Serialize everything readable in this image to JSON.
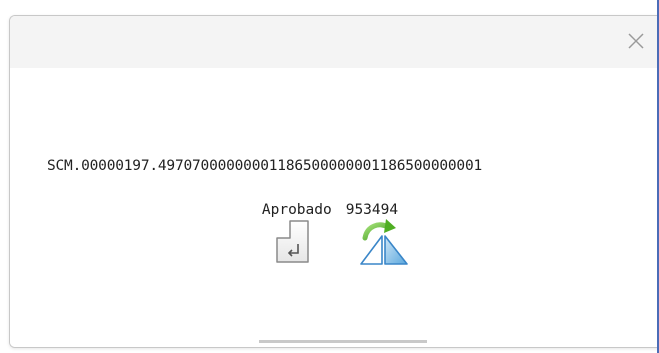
{
  "dialog": {
    "close_icon": "close-icon",
    "message": "SCM.00000197.49707000000001186500000001186500000001",
    "status_label": "Aprobado",
    "status_code": "953494",
    "accept_icon": "enter-return-icon",
    "flip_icon": "flip-mirror-icon"
  },
  "colors": {
    "header_bg": "#f4f4f4",
    "text": "#222222",
    "accent_green": "#5cb82a",
    "accent_blue": "#3a86c8",
    "window_edge": "#4b6cb7"
  }
}
